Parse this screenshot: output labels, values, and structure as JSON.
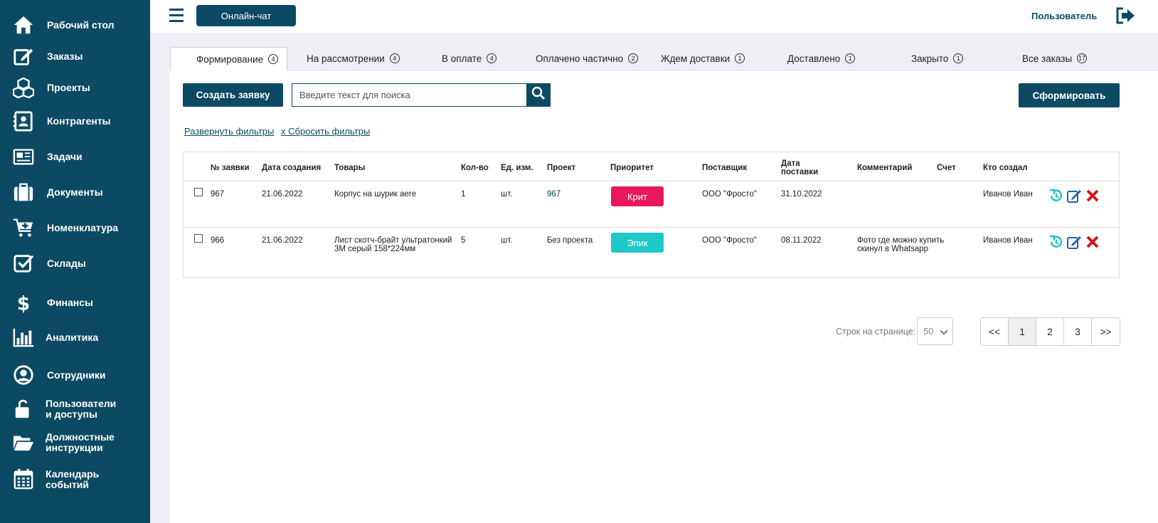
{
  "sidebar": {
    "items": [
      {
        "label": "Рабочий стол",
        "icon": "home-icon"
      },
      {
        "label": "Заказы",
        "icon": "edit-icon"
      },
      {
        "label": "Проекты",
        "icon": "cubes-icon"
      },
      {
        "label": "Контрагенты",
        "icon": "contact-card-icon"
      },
      {
        "label": "Задачи",
        "icon": "newspaper-icon"
      },
      {
        "label": "Документы",
        "icon": "briefcase-icon"
      },
      {
        "label": "Номенклатура",
        "icon": "cart-plus-icon"
      },
      {
        "label": "Склады",
        "icon": "checkbox-icon"
      },
      {
        "label": "Финансы",
        "icon": "dollar-icon"
      },
      {
        "label": "Аналитика",
        "icon": "bar-chart-icon"
      },
      {
        "label": "Сотрудники",
        "icon": "user-circle-icon"
      },
      {
        "label_line1": "Пользователи",
        "label_line2": "и доступы",
        "icon": "unlock-icon"
      },
      {
        "label_line1": "Должностные",
        "label_line2": "инструкции",
        "icon": "folder-open-icon"
      },
      {
        "label_line1": "Календарь",
        "label_line2": "событий",
        "icon": "calendar-icon"
      }
    ]
  },
  "header": {
    "chat_label": "Онлайн-чат",
    "user_label": "Пользователь"
  },
  "tabs": [
    {
      "label": "Формирование",
      "count": "4"
    },
    {
      "label": "На рассмотрении",
      "count": "4"
    },
    {
      "label": "В оплате",
      "count": "4"
    },
    {
      "label": "Оплачено частично",
      "count": "2"
    },
    {
      "label": "Ждем доставки",
      "count": "1"
    },
    {
      "label": "Доставлено",
      "count": "1"
    },
    {
      "label": "Закрыто",
      "count": "1"
    },
    {
      "label": "Все заказы",
      "count": "17"
    }
  ],
  "toolbar": {
    "create_label": "Создать заявку",
    "search_placeholder": "Введите текст для поиска",
    "generate_label": "Сформировать",
    "expand_filters": "Развернуть фильтры",
    "reset_filters": "x Сбросить фильтры"
  },
  "table": {
    "headers": {
      "number": "№ заявки",
      "created": "Дата создания",
      "goods": "Товары",
      "qty": "Кол-во",
      "unit": "Ед. изм.",
      "project": "Проект",
      "priority": "Приоритет",
      "supplier": "Поставщик",
      "delivery_line1": "Дата",
      "delivery_line2": "поставки",
      "comment": "Комментарий",
      "invoice": "Счет",
      "author": "Кто создал"
    },
    "rows": [
      {
        "number": "967",
        "created": "21.06.2022",
        "goods_line1": "Корпус на шурик aere",
        "goods_line2": "",
        "qty": "1",
        "unit": "шт.",
        "project": "967",
        "priority": "Крит",
        "priority_color": "#e8185e",
        "supplier": "ООО \"Фросто\"",
        "delivery": "31.10.2022",
        "comment_line1": "",
        "comment_line2": "",
        "author": "Иванов Иван"
      },
      {
        "number": "966",
        "created": "21.06.2022",
        "goods_line1": "Лист скотч-брайт ультратонкий",
        "goods_line2": "3M серый 158*224мм",
        "qty": "5",
        "unit": "шт.",
        "project": "Без проекта",
        "priority": "Эпик",
        "priority_color": "#1ec8c8",
        "supplier": "ООО \"Фросто\"",
        "delivery": "08.11.2022",
        "comment_line1": "Фото где можно купить",
        "comment_line2": "скинул в Whatsapp",
        "author": "Иванов Иван"
      }
    ]
  },
  "pagination": {
    "rows_label": "Строк на странице:",
    "rows_value": "50",
    "first": "<<",
    "pages": [
      "1",
      "2",
      "3"
    ],
    "last": ">>",
    "current": "1"
  },
  "colors": {
    "brand": "#0c4a63",
    "crit": "#e8185e",
    "epic": "#1ec8c8",
    "history_icon": "#1ec8c8",
    "edit_icon": "#2a5db0",
    "delete_icon": "#d01818"
  }
}
